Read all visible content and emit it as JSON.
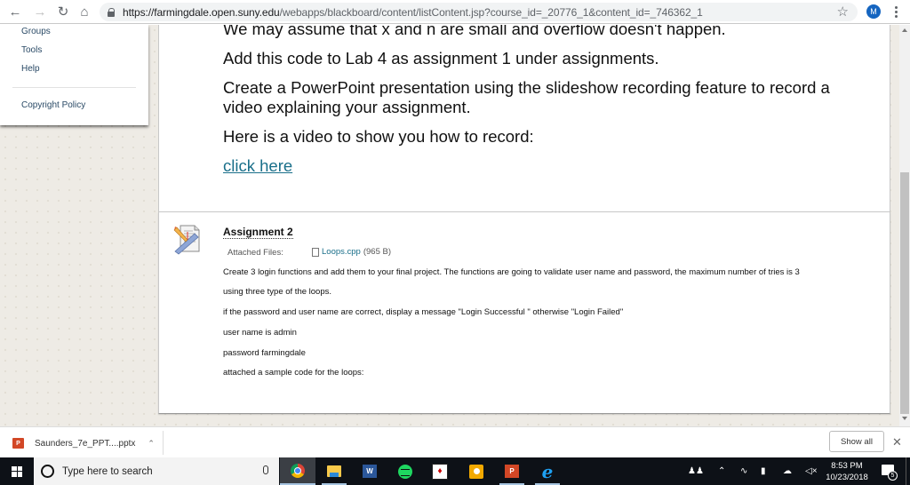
{
  "browser": {
    "url_host": "https://farmingdale.open.suny.edu",
    "url_path": "/webapps/blackboard/content/listContent.jsp?course_id=_20776_1&content_id=_746362_1",
    "profile_initial": "M",
    "icons": {
      "back": "arrow-left-icon",
      "forward": "arrow-right-icon",
      "reload": "reload-icon",
      "home": "home-icon",
      "secure": "lock-icon",
      "bookmark": "star-icon",
      "menu": "kebab-menu-icon"
    }
  },
  "sidebar": {
    "items": [
      {
        "label": "Groups"
      },
      {
        "label": "Tools"
      },
      {
        "label": "Help"
      }
    ],
    "footer_link": "Copyright Policy"
  },
  "content": {
    "paragraphs": [
      "We may assume that x and n are small and overflow doesn't happen.",
      "Add this code to Lab 4 as assignment 1 under assignments.",
      "Create a PowerPoint presentation using the slideshow recording feature to record a video explaining your assignment.",
      "Here is a video to show you how to record:"
    ],
    "video_link": "click here"
  },
  "assignment": {
    "title": "Assignment 2",
    "attached_label": "Attached Files:",
    "file_name": "Loops.cpp",
    "file_size": "(965 B)",
    "lines": [
      "Create 3 login functions and add them to your final project. The functions  are going to validate user name and password, the maximum number of tries is 3",
      "using three type of the loops.",
      "if the password and user name are correct, display a message \"Login Successful \" otherwise \"Login Failed\"",
      "user name is admin",
      "password farmingdale",
      "attached a sample code for the loops:"
    ]
  },
  "downloads": {
    "file_name": "Saunders_7e_PPT....pptx",
    "show_all": "Show all"
  },
  "taskbar": {
    "search_placeholder": "Type here to search",
    "apps": [
      "chrome",
      "file-explorer",
      "word",
      "spotify",
      "dev-tool",
      "app-gold",
      "powerpoint",
      "internet-explorer"
    ],
    "word_label": "W",
    "ppt_label": "P",
    "ie_label": "e",
    "time": "8:53 PM",
    "date": "10/23/2018",
    "notification_count": "5"
  }
}
